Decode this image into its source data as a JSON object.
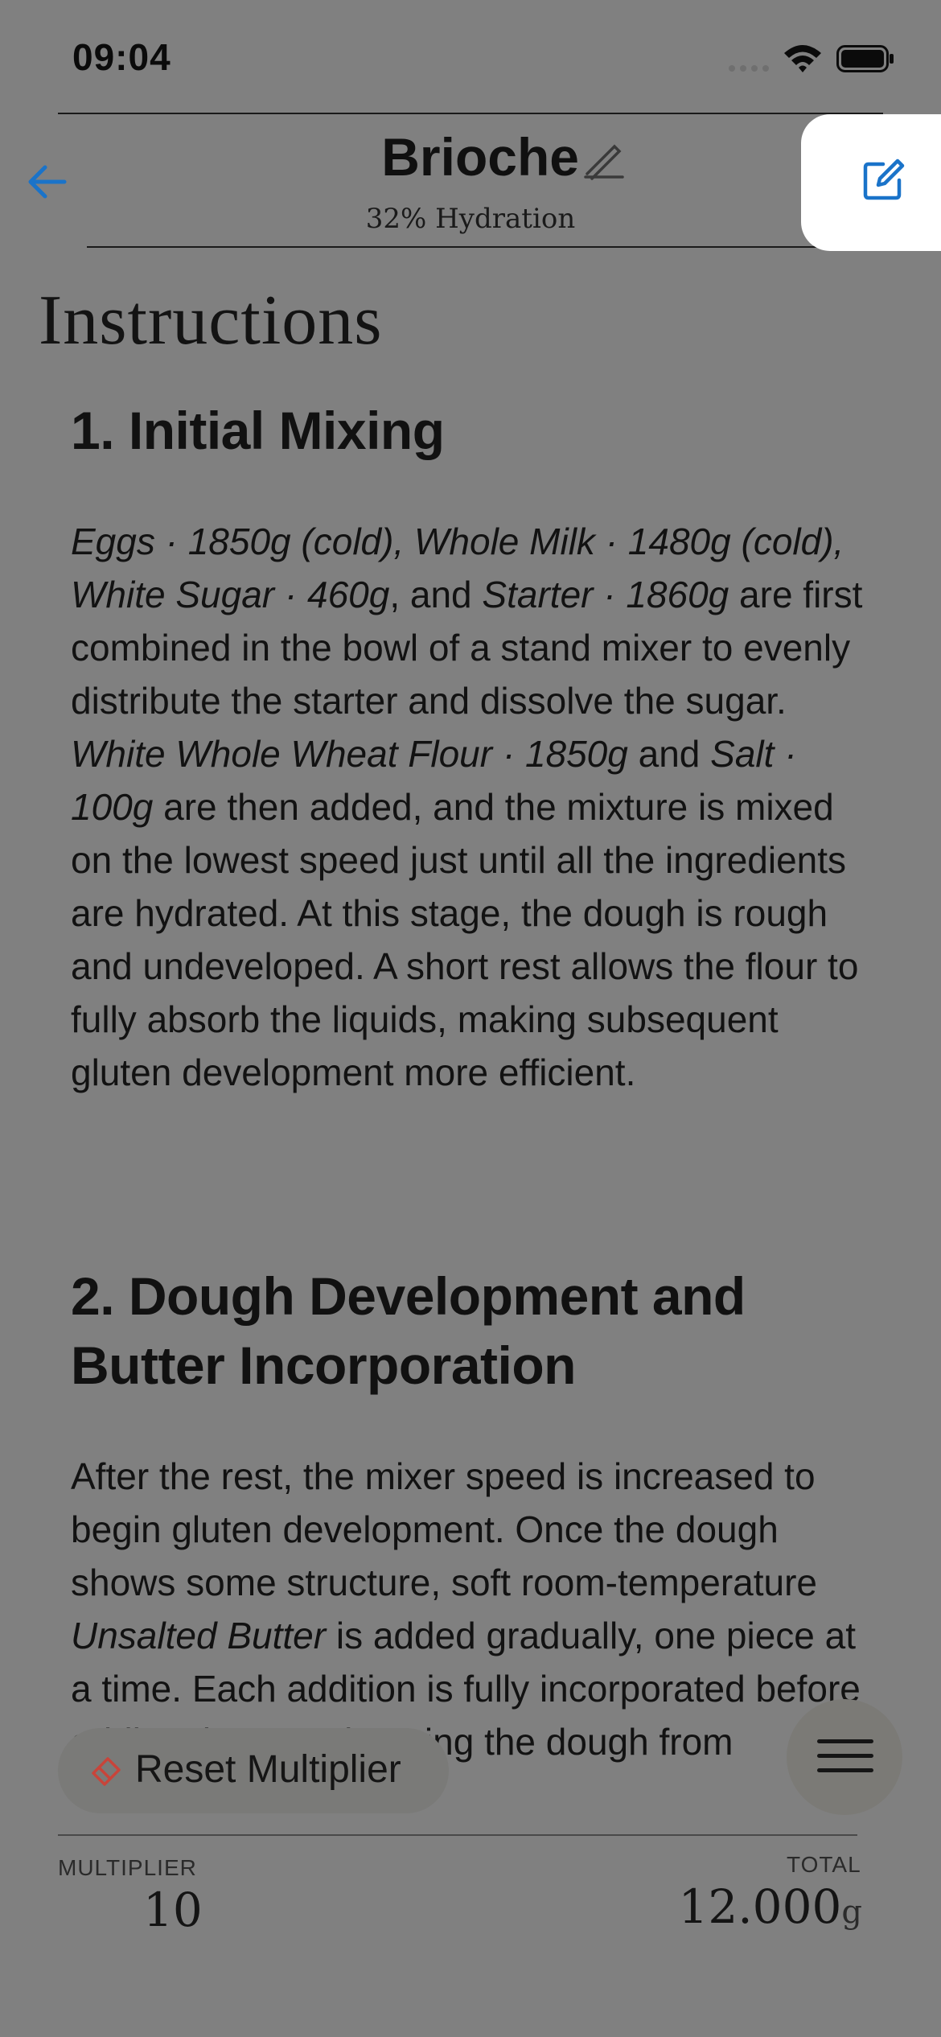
{
  "status_bar": {
    "time": "09:04"
  },
  "nav": {
    "title": "Brioche",
    "subtitle": "32% Hydration"
  },
  "content": {
    "section_heading": "Instructions",
    "steps": [
      {
        "title": "1. Initial Mixing",
        "body": "Eggs · 1850g (cold), Whole Milk · 1480g (cold), White Sugar · 460g, and Starter · 1860g are first combined in the bowl of a stand mixer to evenly distribute the starter and dissolve the sugar. White Whole Wheat Flour · 1850g and Salt · 100g are then added, and the mixture is mixed on the lowest speed just until all the ingredients are hydrated. At this stage, the dough is rough and undeveloped. A short rest allows the flour to fully absorb the liquids, making subsequent gluten development more efficient.",
        "segments": [
          {
            "text": "Eggs · 1850g (cold), Whole Milk · 1480g (cold), White Sugar · 460g",
            "italic": true
          },
          {
            "text": ", and ",
            "italic": false
          },
          {
            "text": "Starter · 1860g",
            "italic": true
          },
          {
            "text": " are first combined in the bowl of a stand mixer to evenly distribute the starter and dissolve the sugar. ",
            "italic": false
          },
          {
            "text": "White Whole Wheat Flour · 1850g",
            "italic": true
          },
          {
            "text": " and ",
            "italic": false
          },
          {
            "text": "Salt · 100g",
            "italic": true
          },
          {
            "text": " are then added, and the mixture is mixed on the lowest speed just until all the ingredients are hydrated. At this stage, the dough is rough and undeveloped. A short rest allows the flour to fully absorb the liquids, making subsequent gluten development more efficient.",
            "italic": false
          }
        ]
      },
      {
        "title": "2. Dough Development and Butter Incorporation",
        "body": "After the rest, the mixer speed is increased to begin gluten development. Once the dough shows some structure, soft room-temperature Unsalted Butter is added gradually, one piece at a time. Each ...rporated before add ...he dough from",
        "segments": [
          {
            "text": "After the rest, the mixer speed is increased to begin gluten development. Once the dough shows some structure, soft room-temperature ",
            "italic": false
          },
          {
            "text": "Unsalted Butter",
            "italic": true
          },
          {
            "text": " is added gradually, one piece at a time. Each addition is fully incorporated before adding the next, keeping the dough from",
            "italic": false
          }
        ]
      }
    ]
  },
  "controls": {
    "reset_label": "Reset Multiplier"
  },
  "footer": {
    "multiplier_label": "MULTIPLIER",
    "multiplier_value": "10",
    "total_label": "TOTAL",
    "total_value": "12.000",
    "total_unit": "g"
  },
  "colors": {
    "background": "#808080",
    "accent": "#1a73c9",
    "reset_icon": "#c8443a",
    "card": "#ffffff"
  },
  "icons": {
    "back": "arrow-left-icon",
    "title_edit": "pencil-icon",
    "compose": "compose-icon",
    "reset": "eraser-icon",
    "menu": "hamburger-icon"
  }
}
